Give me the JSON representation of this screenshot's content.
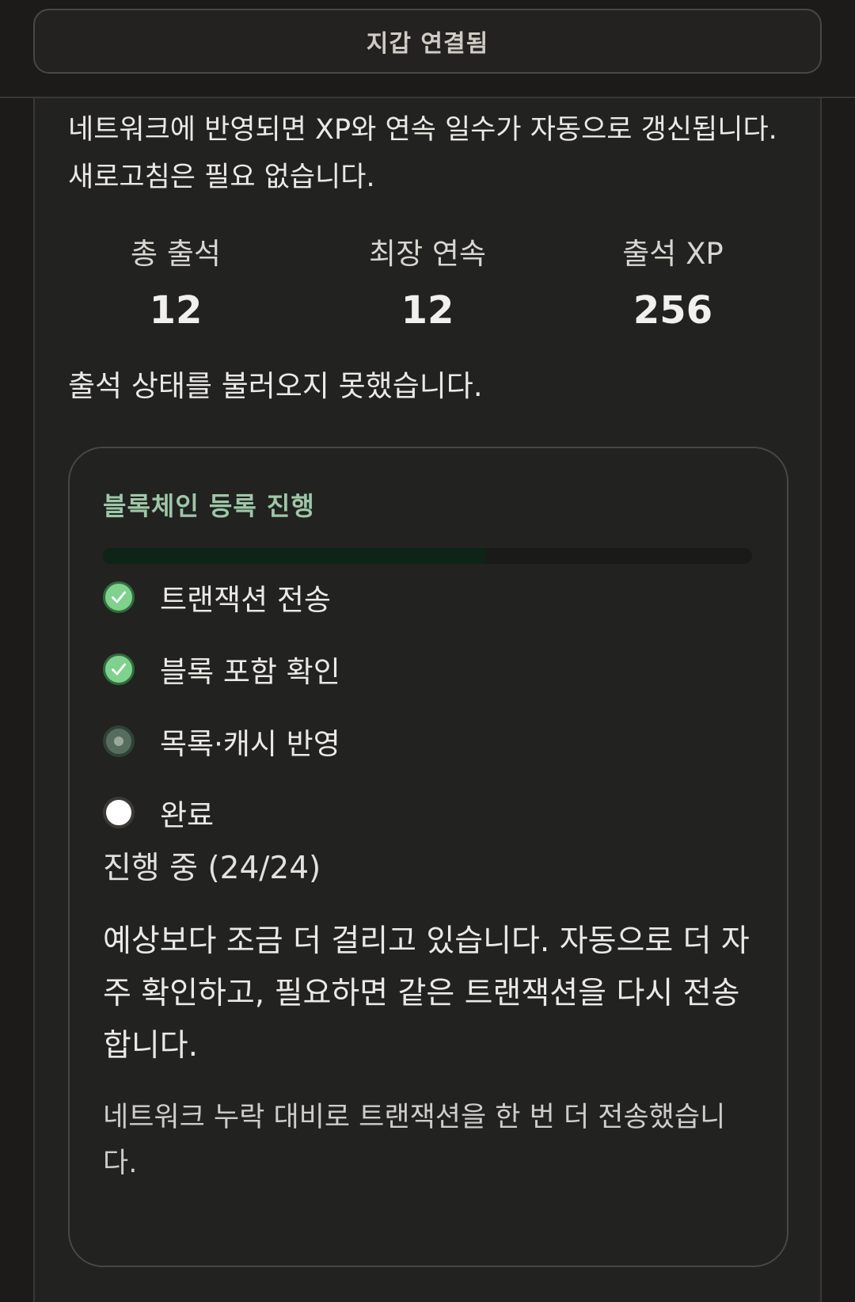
{
  "header": {
    "wallet_button_label": "지갑 연결됨"
  },
  "info": {
    "text": "네트워크에 반영되면 XP와 연속 일수가 자동으로 갱신됩니다. 새로고침은 필요 없습니다."
  },
  "stats": [
    {
      "label": "총 출석",
      "value": "12"
    },
    {
      "label": "최장 연속",
      "value": "12"
    },
    {
      "label": "출석 XP",
      "value": "256"
    }
  ],
  "error": {
    "text": "출석 상태를 불러오지 못했습니다."
  },
  "registration": {
    "title": "블록체인 등록 진행",
    "progress_fraction": 0.59,
    "steps": [
      {
        "label": "트랜잭션 전송",
        "state": "done",
        "icon": "check-circle-icon"
      },
      {
        "label": "블록 포함 확인",
        "state": "done",
        "icon": "check-circle-icon"
      },
      {
        "label": "목록·캐시 반영",
        "state": "active",
        "icon": "active-step-icon"
      },
      {
        "label": "완료",
        "state": "pending",
        "icon": "pending-step-icon"
      }
    ],
    "status": "진행 중 (24/24)",
    "note": "예상보다 조금 더 걸리고 있습니다. 자동으로 더 자주 확인하고, 필요하면 같은 트랜잭션을 다시 전송합니다.",
    "resend_note": "네트워크 누락 대비로 트랜잭션을 한 번 더 전송했습니다."
  },
  "colors": {
    "accent_title": "#9ec7a7",
    "done_icon": "#7fd18d",
    "progress_fill": "#0e2417"
  }
}
